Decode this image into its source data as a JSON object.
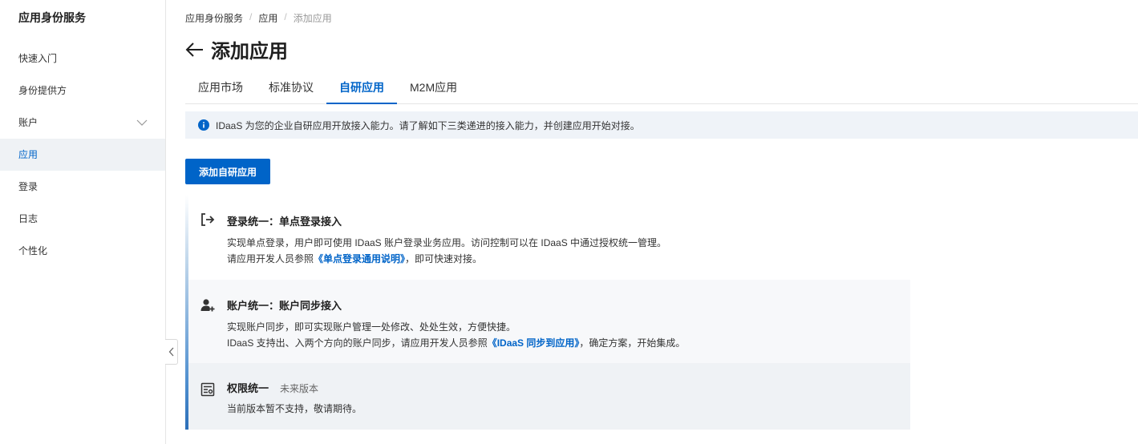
{
  "sidebar": {
    "title": "应用身份服务",
    "items": [
      {
        "label": "快速入门"
      },
      {
        "label": "身份提供方"
      },
      {
        "label": "账户"
      },
      {
        "label": "应用"
      },
      {
        "label": "登录"
      },
      {
        "label": "日志"
      },
      {
        "label": "个性化"
      }
    ]
  },
  "breadcrumb": [
    "应用身份服务",
    "应用",
    "添加应用"
  ],
  "page": {
    "title": "添加应用"
  },
  "tabs": [
    {
      "label": "应用市场"
    },
    {
      "label": "标准协议"
    },
    {
      "label": "自研应用",
      "active": true
    },
    {
      "label": "M2M应用"
    }
  ],
  "notice": {
    "text": "IDaaS 为您的企业自研应用开放接入能力。请了解如下三类递进的接入能力，并创建应用开始对接。"
  },
  "add_button": {
    "label": "添加自研应用"
  },
  "steps": [
    {
      "icon": "login-arrow-icon",
      "title": "登录统一：单点登录接入",
      "line1": "实现单点登录，用户即可使用 IDaaS 账户登录业务应用。访问控制可以在 IDaaS 中通过授权统一管理。",
      "line2_pre": "请应用开发人员参照",
      "line2_link": "《单点登录通用说明》",
      "line2_post": "，即可快速对接。"
    },
    {
      "icon": "user-add-icon",
      "title": "账户统一：账户同步接入",
      "line1": "实现账户同步，即可实现账户管理一处修改、处处生效，方便快捷。",
      "line2_pre": "IDaaS 支持出、入两个方向的账户同步，请应用开发人员参照",
      "line2_link": "《IDaaS 同步到应用》",
      "line2_post": "，确定方案，开始集成。"
    },
    {
      "icon": "permission-icon",
      "title": "权限统一",
      "tag": "未来版本",
      "line1": "当前版本暂不支持，敬请期待。"
    }
  ],
  "colors": {
    "accent": "#0064c8",
    "active_bg": "#eff2f5",
    "notice_bg": "#eff3f8"
  }
}
